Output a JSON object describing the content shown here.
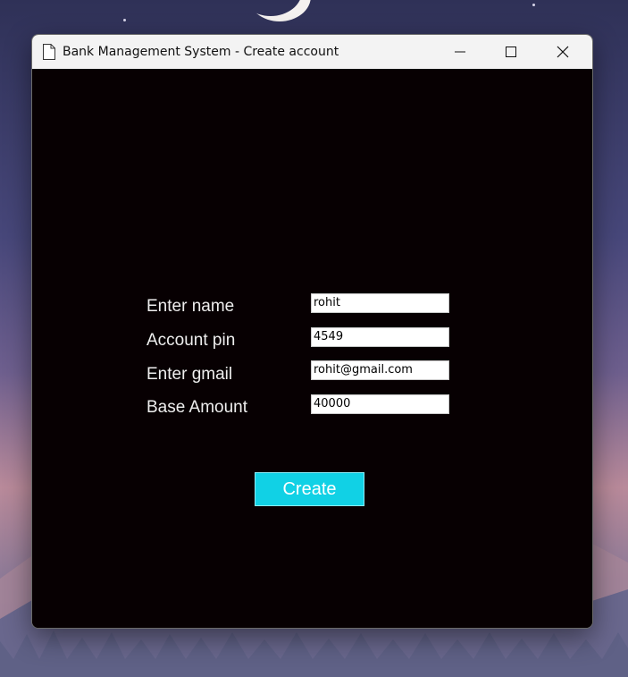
{
  "window": {
    "title": "Bank Management System - Create account",
    "controls": {
      "minimize_icon": "minimize-icon",
      "maximize_icon": "maximize-icon",
      "close_icon": "close-icon"
    }
  },
  "form": {
    "fields": [
      {
        "label": "Enter name",
        "value": "rohit"
      },
      {
        "label": "Account pin",
        "value": "4549"
      },
      {
        "label": "Enter gmail",
        "value": "rohit@gmail.com"
      },
      {
        "label": "Base Amount",
        "value": "40000"
      }
    ],
    "create_label": "Create"
  },
  "colors": {
    "window_background": "#070002",
    "titlebar_background": "#f3f3f3",
    "label_text": "#eeeeee",
    "button_background": "#11d1e5",
    "button_text": "#ffffff"
  }
}
